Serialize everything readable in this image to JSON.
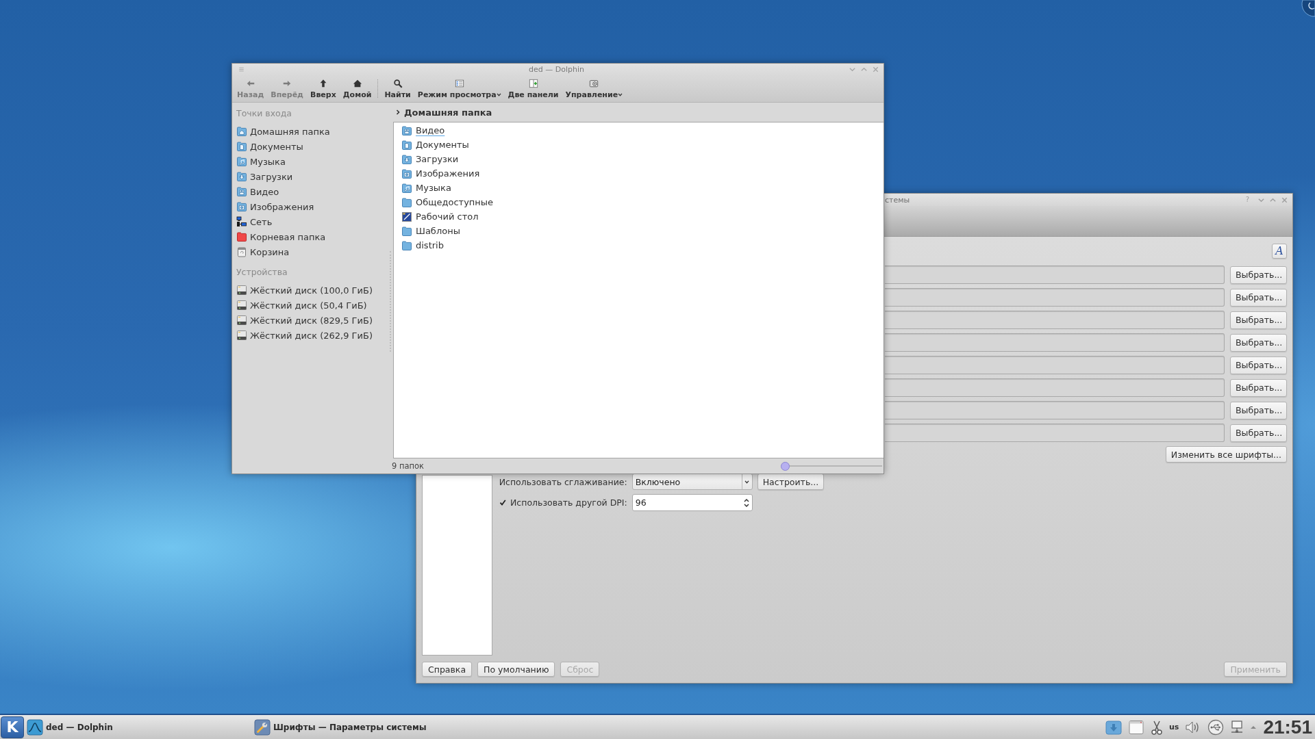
{
  "dolphin": {
    "title": "ded — Dolphin",
    "toolbar": [
      {
        "kind": "back",
        "label": "Назад",
        "disabled": true,
        "dropdown": false
      },
      {
        "kind": "forward",
        "label": "Вперёд",
        "disabled": true,
        "dropdown": false
      },
      {
        "kind": "up",
        "label": "Вверх",
        "disabled": false,
        "dropdown": false
      },
      {
        "kind": "home",
        "label": "Домой",
        "disabled": false,
        "dropdown": false
      },
      {
        "kind": "separator"
      },
      {
        "kind": "search",
        "label": "Найти",
        "disabled": false,
        "dropdown": false
      },
      {
        "kind": "view",
        "label": "Режим просмотра",
        "disabled": false,
        "dropdown": true
      },
      {
        "kind": "split",
        "label": "Две панели",
        "disabled": false,
        "dropdown": false
      },
      {
        "kind": "manage",
        "label": "Управление",
        "disabled": false,
        "dropdown": true
      }
    ],
    "places_heading": "Точки входа",
    "places": [
      {
        "kind": "home",
        "label": "Домашняя папка",
        "selected": false
      },
      {
        "kind": "documents",
        "label": "Документы",
        "selected": false
      },
      {
        "kind": "music",
        "label": "Музыка",
        "selected": false
      },
      {
        "kind": "downloads",
        "label": "Загрузки",
        "selected": false
      },
      {
        "kind": "video",
        "label": "Видео",
        "selected": false
      },
      {
        "kind": "pictures",
        "label": "Изображения",
        "selected": false
      },
      {
        "kind": "network",
        "label": "Сеть",
        "selected": false
      },
      {
        "kind": "root",
        "label": "Корневая папка",
        "selected": false
      },
      {
        "kind": "trash",
        "label": "Корзина",
        "selected": false
      }
    ],
    "devices_heading": "Устройства",
    "devices": [
      {
        "label": "Жёсткий диск (100,0 ГиБ)",
        "selected": false
      },
      {
        "label": "Жёсткий диск (50,4 ГиБ)",
        "selected": false
      },
      {
        "label": "Жёсткий диск (829,5 ГиБ)",
        "selected": false
      },
      {
        "label": "Жёсткий диск (262,9 ГиБ)",
        "selected": false
      }
    ],
    "breadcrumb": "Домашняя папка",
    "files": [
      {
        "kind": "video",
        "name": "Видео",
        "selected": false,
        "hovered": true
      },
      {
        "kind": "documents",
        "name": "Документы",
        "selected": false,
        "hovered": false
      },
      {
        "kind": "downloads",
        "name": "Загрузки",
        "selected": false,
        "hovered": false
      },
      {
        "kind": "pictures",
        "name": "Изображения",
        "selected": false,
        "hovered": false
      },
      {
        "kind": "music",
        "name": "Музыка",
        "selected": false,
        "hovered": false
      },
      {
        "kind": "folder",
        "name": "Общедоступные",
        "selected": false,
        "hovered": false
      },
      {
        "kind": "desktop",
        "name": "Рабочий стол",
        "selected": false,
        "hovered": false
      },
      {
        "kind": "folder",
        "name": "Шаблоны",
        "selected": false,
        "hovered": false
      },
      {
        "kind": "folder",
        "name": "distrib",
        "selected": false,
        "hovered": false
      }
    ],
    "status": "9 папок",
    "zoom_slider": {
      "level": 0
    }
  },
  "settings": {
    "title": "стемы",
    "help": "?",
    "font_button": "A",
    "font_rows": [
      {
        "button": "Выбрать..."
      },
      {
        "button": "Выбрать..."
      },
      {
        "button": "Выбрать..."
      },
      {
        "button": "Выбрать..."
      },
      {
        "button": "Выбрать..."
      },
      {
        "button": "Выбрать..."
      },
      {
        "button": "Выбрать..."
      },
      {
        "button": "Выбрать..."
      }
    ],
    "change_all": "Изменить все шрифты...",
    "antialiasing": {
      "label": "Использовать сглаживание:",
      "value": "Включено",
      "button": "Настроить..."
    },
    "dpi": {
      "label": "Использовать другой DPI:",
      "checked": true,
      "value": "96"
    },
    "buttons_left": [
      {
        "label": "Справка",
        "disabled": false
      },
      {
        "label": "По умолчанию",
        "disabled": false
      },
      {
        "label": "Сброс",
        "disabled": true
      }
    ],
    "buttons_right": [
      {
        "label": "Применить",
        "disabled": true
      }
    ]
  },
  "taskbar": {
    "launcher": "K",
    "tasks": [
      {
        "kind": "dolphin",
        "label": "ded — Dolphin"
      },
      {
        "kind": "settings",
        "label": "Шрифты — Параметры системы"
      }
    ],
    "keyboard_layout": "us",
    "clock": "21:51"
  }
}
